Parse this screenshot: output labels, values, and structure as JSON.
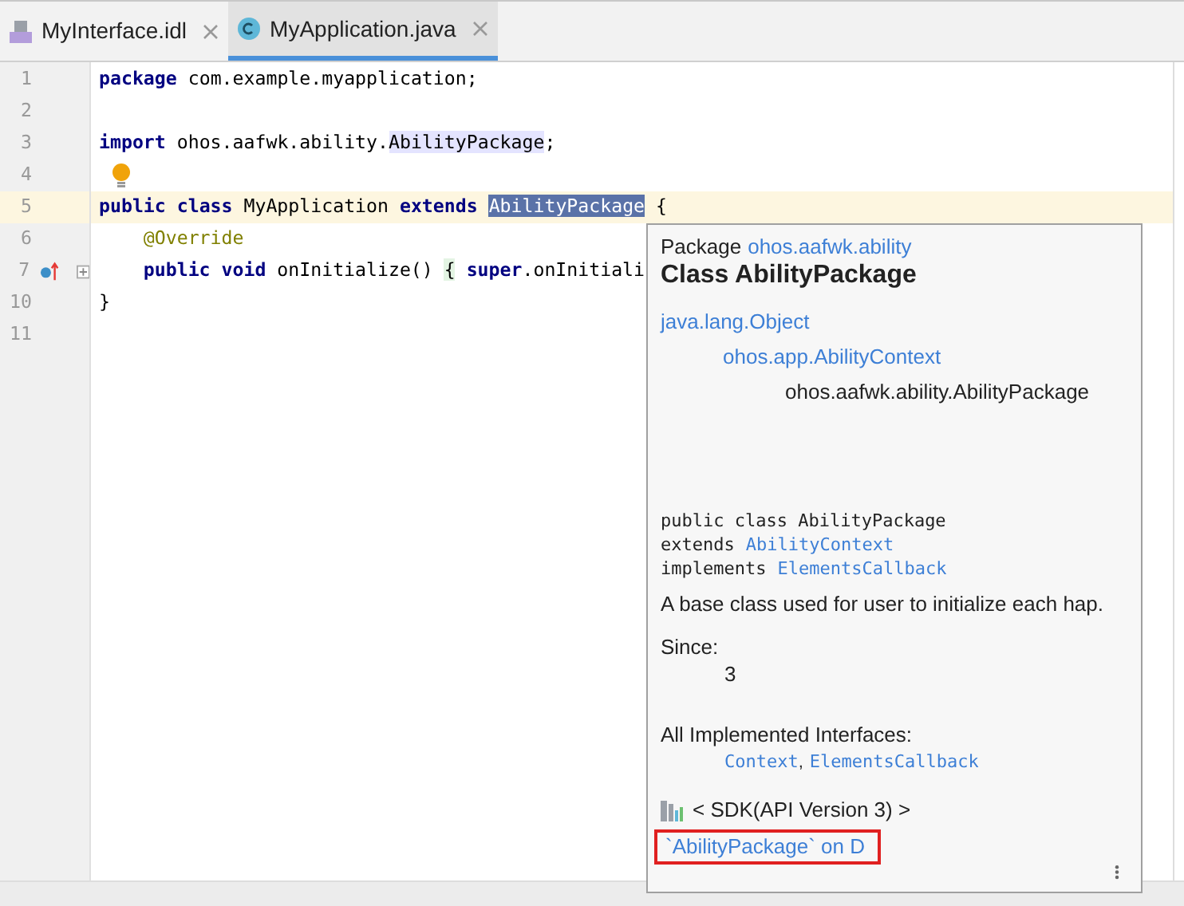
{
  "tabs": [
    {
      "label": "MyInterface.idl",
      "kind": "idl",
      "selected": false
    },
    {
      "label": "MyApplication.java",
      "kind": "class",
      "selected": true
    }
  ],
  "editor": {
    "lines": [
      {
        "number": "1",
        "current": false,
        "tokens": [
          {
            "text": "package",
            "kind": "keyword"
          },
          {
            "text": " com.example.myapplication;",
            "kind": "plain"
          }
        ]
      },
      {
        "number": "2",
        "current": false
      },
      {
        "number": "3",
        "current": false,
        "tokens": [
          {
            "text": "import",
            "kind": "keyword"
          },
          {
            "text": " ohos.aafwk.ability.",
            "kind": "plain"
          },
          {
            "text": "AbilityPackage",
            "kind": "usage"
          },
          {
            "text": ";",
            "kind": "plain"
          }
        ]
      },
      {
        "number": "4",
        "current": false,
        "bulb": true
      },
      {
        "number": "5",
        "current": true,
        "tokens": [
          {
            "text": "public class",
            "kind": "keyword"
          },
          {
            "text": " MyApplication ",
            "kind": "plain"
          },
          {
            "text": "extends",
            "kind": "keyword"
          },
          {
            "text": "AbilityPackage",
            "kind": "selected"
          },
          {
            "text": " {",
            "kind": "plain"
          }
        ]
      },
      {
        "number": "6",
        "current": false,
        "nested": true,
        "tokens": [
          {
            "text": "@Override",
            "kind": "annotation"
          }
        ]
      },
      {
        "number": "7",
        "current": false,
        "nested": true,
        "override": true,
        "folded": true,
        "tokens": [
          {
            "text": "public void",
            "kind": "keyword"
          },
          {
            "text": " onInitialize() ",
            "kind": "plain"
          },
          {
            "text": "{",
            "kind": "brace"
          },
          {
            "text": "super",
            "kind": "keyword"
          },
          {
            "text": ".onInitiali",
            "kind": "plain"
          }
        ]
      },
      {
        "number": "10",
        "current": false,
        "tokens": [
          {
            "text": "}",
            "kind": "plain"
          }
        ]
      },
      {
        "number": "11",
        "current": false
      }
    ]
  },
  "doc_popup": {
    "package_label": "Package",
    "package_link": "ohos.aafwk.ability",
    "title": "Class AbilityPackage",
    "hierarchy": [
      {
        "text": "java.lang.Object",
        "link": true,
        "children": [
          {
            "text": "ohos.app.AbilityContext",
            "link": true,
            "children": [
              {
                "text": "ohos.aafwk.ability.AbilityPackage",
                "link": false
              }
            ]
          }
        ]
      }
    ],
    "signature": [
      {
        "text": "public class AbilityPackage"
      },
      {
        "text": "extends",
        "link": "AbilityContext"
      },
      {
        "text": "implements",
        "link": "ElementsCallback"
      }
    ],
    "description": "A base class used for user to initialize each hap.",
    "since_label": "Since:",
    "since_value": "3",
    "interfaces_label": "All Implemented Interfaces:",
    "interfaces": [
      "Context",
      "ElementsCallback"
    ],
    "interfaces_separator": ",",
    "sdk": "< SDK(API Version 3) >",
    "external_link": "`AbilityPackage` on D"
  }
}
